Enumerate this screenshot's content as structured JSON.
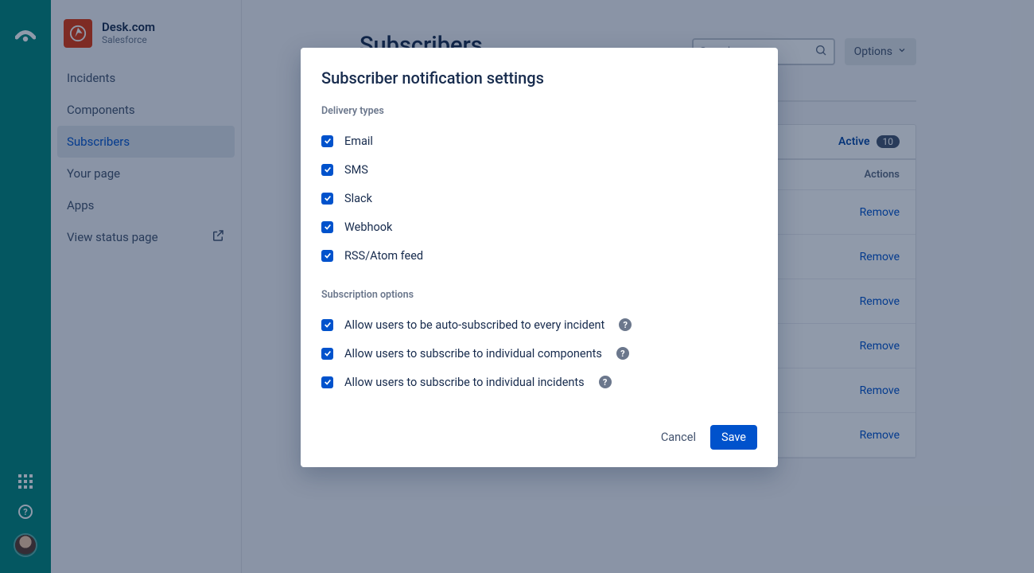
{
  "app": {
    "title": "Desk.com",
    "subtitle": "Salesforce"
  },
  "nav": {
    "incidents": "Incidents",
    "components": "Components",
    "subscribers": "Subscribers",
    "your_page": "Your page",
    "apps": "Apps",
    "view_status": "View status page"
  },
  "page": {
    "title": "Subscribers",
    "search_placeholder": "Search",
    "options_label": "Options",
    "active_label": "Active",
    "active_count": "10",
    "actions_col": "Actions",
    "remove_label": "Remove"
  },
  "modal": {
    "title": "Subscriber notification settings",
    "section_delivery": "Delivery types",
    "section_subscription": "Subscription options",
    "delivery": {
      "email": "Email",
      "sms": "SMS",
      "slack": "Slack",
      "webhook": "Webhook",
      "rss": "RSS/Atom feed"
    },
    "subscription": {
      "auto": "Allow users to be auto-subscribed to every incident",
      "components": "Allow users to subscribe to individual components",
      "incidents": "Allow users to subscribe to individual incidents"
    },
    "cancel": "Cancel",
    "save": "Save"
  }
}
